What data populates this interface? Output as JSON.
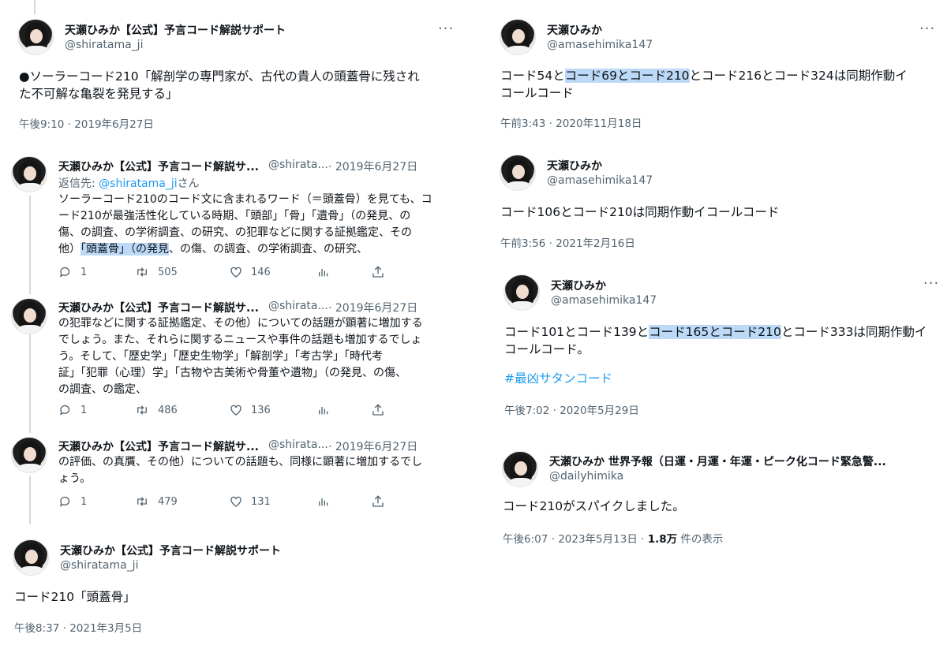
{
  "left": {
    "main_tweet": {
      "name": "天瀬ひみか【公式】予言コード解説サポート",
      "handle": "@shiratama_ji",
      "text": "●ソーラーコード210「解剖学の専門家が、古代の貴人の頭蓋骨に残された不可解な亀裂を発見する」",
      "text_line1": "●ソーラーコード210「解剖学の専門家が、古代の貴人の頭蓋骨に残され",
      "text_line2": "た不可解な亀裂を発見する」",
      "timestamp": "午後9:10 · 2019年6月27日"
    },
    "replies": [
      {
        "name": "天瀬ひみか【公式】予言コード解説サ...",
        "handle": "@shirata...",
        "date": "· 2019年6月27日",
        "reply_prefix": "返信先: ",
        "reply_to": "@shiratama_ji",
        "reply_suffix": "さん",
        "line1": "ソーラーコード210のコード文に含まれるワード（＝頭蓋骨）を見ても、コ",
        "line2": "ード210が最強活性化している時期、「頭部」「骨」「遺骨」（の発見、の",
        "line3": "傷、の調査、の学術調査、の研究、の犯罪などに関する証拠鑑定、その",
        "line4_pre": "他）",
        "line4_hl": "「頭蓋骨」（の発見",
        "line4_post": "、の傷、の調査、の学術調査、の研究、",
        "stats": {
          "replies": "1",
          "retweets": "505",
          "likes": "146"
        }
      },
      {
        "name": "天瀬ひみか【公式】予言コード解説サ...",
        "handle": "@shirata...",
        "date": "· 2019年6月27日",
        "line1": "の犯罪などに関する証拠鑑定、その他）についての話題が顕著に増加する",
        "line2": "でしょう。また、それらに関するニュースや事件の話題も増加するでしょ",
        "line3": "う。そして、「歴史学」「歴史生物学」「解剖学」「考古学」「時代考",
        "line4": "証」「犯罪（心理）学」「古物や古美術や骨董や遺物」（の発見、の傷、",
        "line5": "の調査、の鑑定、",
        "stats": {
          "replies": "1",
          "retweets": "486",
          "likes": "136"
        }
      },
      {
        "name": "天瀬ひみか【公式】予言コード解説サ...",
        "handle": "@shirata...",
        "date": "· 2019年6月27日",
        "line1": "の評価、の真贋、その他）についての話題も、同様に顕著に増加するでし",
        "line2": "ょう。",
        "stats": {
          "replies": "1",
          "retweets": "479",
          "likes": "131"
        }
      }
    ],
    "bottom_tweet": {
      "name": "天瀬ひみか【公式】予言コード解説サポート",
      "handle": "@shiratama_ji",
      "text": "コード210「頭蓋骨」",
      "timestamp": "午後8:37 · 2021年3月5日"
    }
  },
  "right": {
    "tweet1": {
      "name": "天瀬ひみか",
      "handle": "@amasehimika147",
      "pre": "コード54と",
      "hl": "コード69とコード210",
      "post": "とコード216とコード324は同期作動イ",
      "line2": "コールコード",
      "timestamp": "午前3:43 · 2020年11月18日"
    },
    "tweet2": {
      "name": "天瀬ひみか",
      "handle": "@amasehimika147",
      "text": "コード106とコード210は同期作動イコールコード",
      "timestamp": "午前3:56 · 2021年2月16日"
    },
    "tweet3": {
      "name": "天瀬ひみか",
      "handle": "@amasehimika147",
      "pre": "コード101とコード139と",
      "hl": "コード165とコード210",
      "post": "とコード333は同期作動イ",
      "line2": "コールコード。",
      "hashtag": "#最凶サタンコード",
      "timestamp": "午後7:02 · 2020年5月29日"
    },
    "tweet4": {
      "name": "天瀬ひみか 世界予報（日運・月運・年運・ピーク化コード緊急警...",
      "handle": "@dailyhimika",
      "text": "コード210がスパイクしました。",
      "timestamp_pre": "午後6:07 · 2023年5月13日 · ",
      "views_count": "1.8万",
      "views_label": " 件の表示"
    }
  },
  "icons": {
    "more": "more-dots-icon",
    "reply": "reply-bubble-icon",
    "retweet": "retweet-icon",
    "like": "heart-icon",
    "analytics": "analytics-bars-icon",
    "share": "share-upload-icon"
  },
  "colors": {
    "highlight": "#bcd9f7",
    "link": "#1d9bf0",
    "muted": "#536471"
  }
}
